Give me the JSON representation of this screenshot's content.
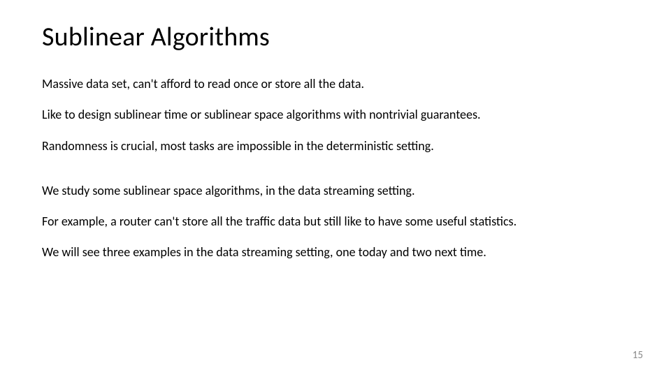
{
  "slide": {
    "title": "Sublinear Algorithms",
    "paragraphs": {
      "p1": "Massive data set, can't afford to read once or store all the data.",
      "p2": "Like to design sublinear time or sublinear space algorithms with nontrivial guarantees.",
      "p3": "Randomness is crucial, most tasks are impossible in the deterministic setting.",
      "p4": "We study some sublinear space algorithms, in the data streaming setting.",
      "p5": "For example, a router can't store all the traffic data but still like to have some useful statistics.",
      "p6": "We will see three examples in the data streaming setting, one today and two next time."
    },
    "page_number": "15"
  }
}
